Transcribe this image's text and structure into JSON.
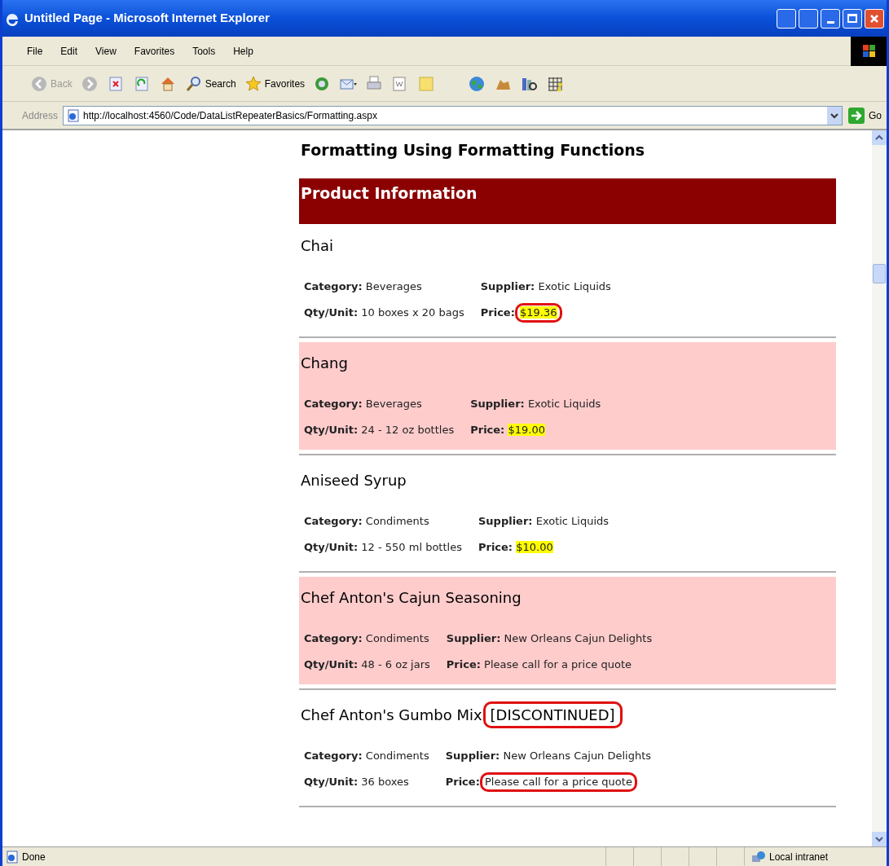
{
  "window": {
    "title": "Untitled Page - Microsoft Internet Explorer"
  },
  "menu": [
    "File",
    "Edit",
    "View",
    "Favorites",
    "Tools",
    "Help"
  ],
  "toolbar": [
    {
      "kind": "back",
      "label": "Back"
    },
    {
      "kind": "forward"
    },
    {
      "kind": "stop"
    },
    {
      "kind": "refresh"
    },
    {
      "kind": "home"
    },
    {
      "kind": "search",
      "label": "Search"
    },
    {
      "kind": "favorites",
      "label": "Favorites"
    },
    {
      "kind": "media"
    },
    {
      "kind": "mail"
    },
    {
      "kind": "print"
    },
    {
      "kind": "edit"
    },
    {
      "kind": "note"
    },
    {
      "kind": "globe"
    },
    {
      "kind": "tool"
    },
    {
      "kind": "research"
    },
    {
      "kind": "grid"
    }
  ],
  "address": {
    "label": "Address",
    "value": "http://localhost:4560/Code/DataListRepeaterBasics/Formatting.aspx",
    "go": "Go"
  },
  "page": {
    "heading": "Formatting Using Formatting Functions",
    "band": "Product Information",
    "products": [
      {
        "name": "Chai",
        "alternate": false,
        "row1": [
          {
            "label": "Category:",
            "value": "Beverages"
          },
          {
            "label": "Supplier:",
            "value": "Exotic Liquids"
          }
        ],
        "row2": [
          {
            "label": "Qty/Unit:",
            "value": "10 boxes x 20 bags"
          },
          {
            "label": "Price:",
            "value": "$19.36",
            "highlighted": true,
            "circled": true
          }
        ]
      },
      {
        "name": "Chang",
        "alternate": true,
        "row1": [
          {
            "label": "Category:",
            "value": "Beverages"
          },
          {
            "label": "Supplier:",
            "value": "Exotic Liquids"
          }
        ],
        "row2": [
          {
            "label": "Qty/Unit:",
            "value": "24 - 12 oz bottles"
          },
          {
            "label": "Price:",
            "value": "$19.00",
            "highlighted": true,
            "circled": false
          }
        ]
      },
      {
        "name": "Aniseed Syrup",
        "alternate": false,
        "row1": [
          {
            "label": "Category:",
            "value": "Condiments"
          },
          {
            "label": "Supplier:",
            "value": "Exotic Liquids"
          }
        ],
        "row2": [
          {
            "label": "Qty/Unit:",
            "value": "12 - 550 ml bottles"
          },
          {
            "label": "Price:",
            "value": "$10.00",
            "highlighted": true,
            "circled": false
          }
        ]
      },
      {
        "name": "Chef Anton's Cajun Seasoning",
        "alternate": true,
        "row1": [
          {
            "label": "Category:",
            "value": "Condiments"
          },
          {
            "label": "Supplier:",
            "value": "New Orleans Cajun Delights"
          }
        ],
        "row2": [
          {
            "label": "Qty/Unit:",
            "value": "48 - 6 oz jars"
          },
          {
            "label": "Price:",
            "value": "Please call for a price quote",
            "highlighted": false,
            "circled": false
          }
        ]
      },
      {
        "name": "Chef Anton's Gumbo Mix",
        "tag": {
          "text": "[DISCONTINUED]",
          "circled": true
        },
        "alternate": false,
        "row1": [
          {
            "label": "Category:",
            "value": "Condiments"
          },
          {
            "label": "Supplier:",
            "value": "New Orleans Cajun Delights"
          }
        ],
        "row2": [
          {
            "label": "Qty/Unit:",
            "value": "36 boxes"
          },
          {
            "label": "Price:",
            "value": "Please call for a price quote",
            "highlighted": false,
            "circled": true
          }
        ]
      }
    ]
  },
  "status_bar": {
    "text": "Done",
    "zone": "Local intranet"
  }
}
